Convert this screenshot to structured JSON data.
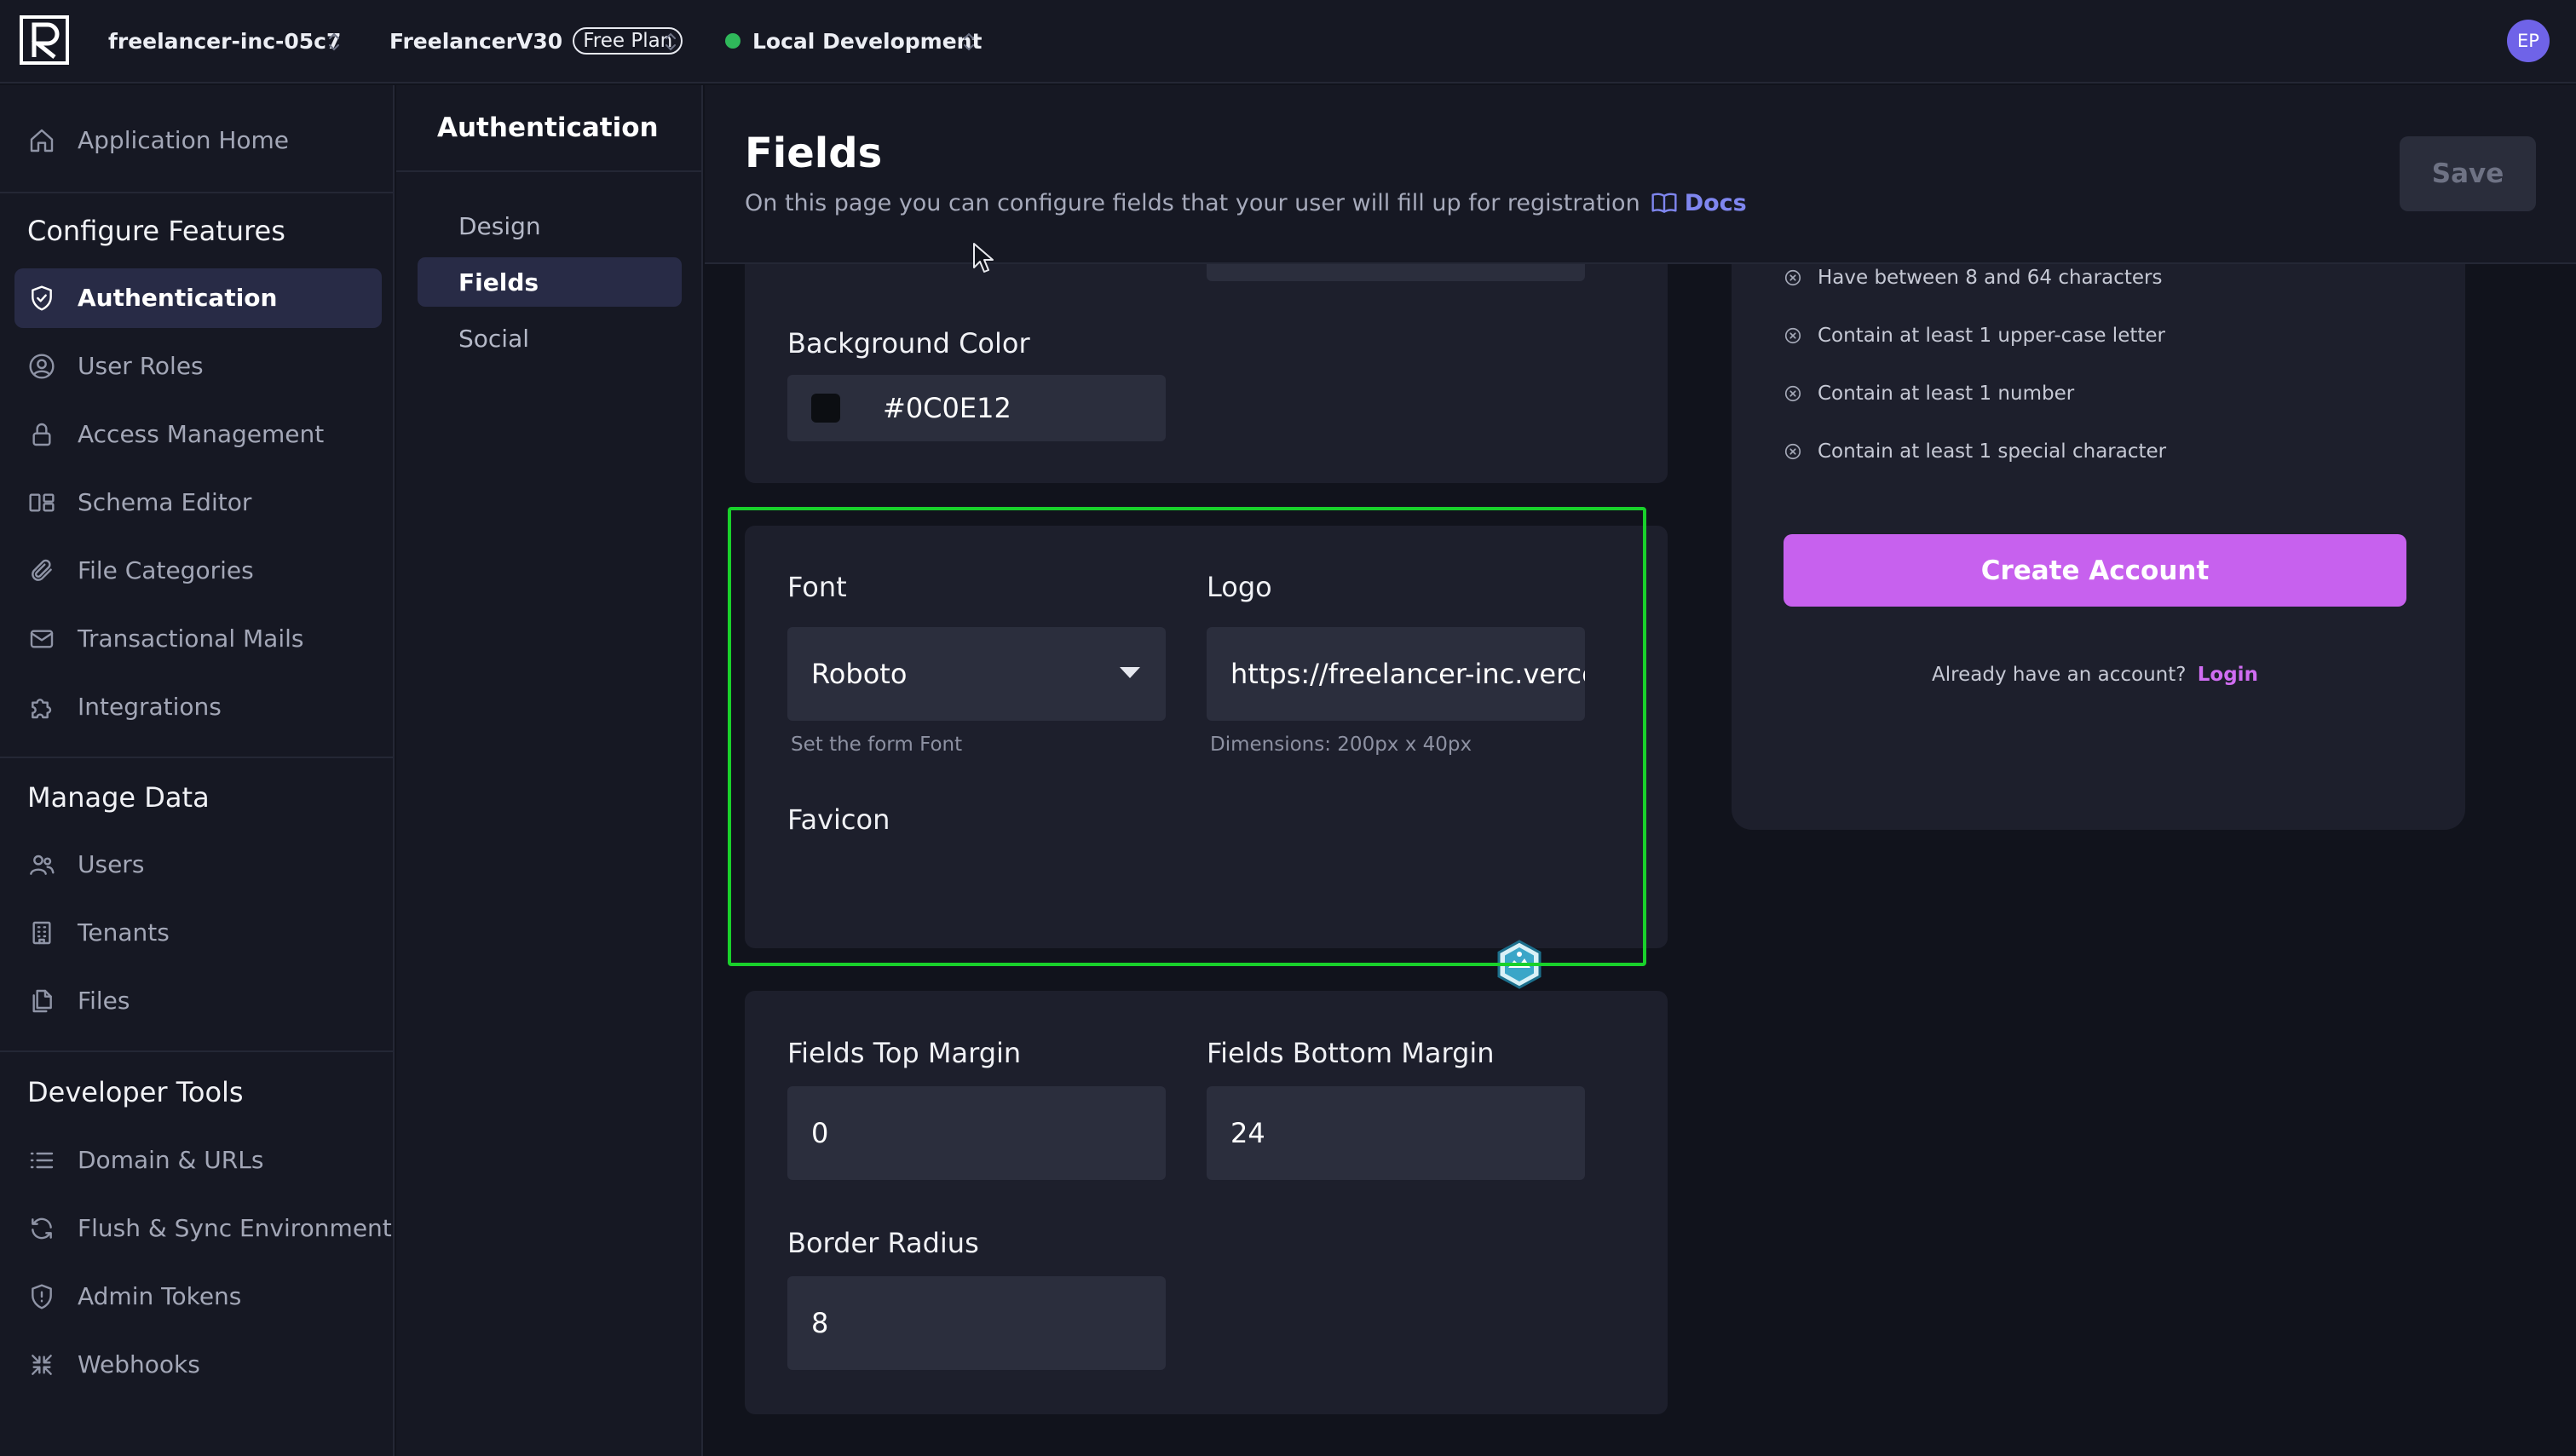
{
  "topbar": {
    "org": "freelancer-inc-05c7",
    "project": "FreelancerV30",
    "plan": "Free Plan",
    "environment": "Local Development",
    "avatar_initials": "EP"
  },
  "sidebar": {
    "home": "Application Home",
    "configure_title": "Configure Features",
    "configure_items": [
      {
        "label": "Authentication",
        "icon": "shield-check-icon",
        "active": true
      },
      {
        "label": "User Roles",
        "icon": "user-circle-icon"
      },
      {
        "label": "Access Management",
        "icon": "lock-icon"
      },
      {
        "label": "Schema Editor",
        "icon": "schema-icon"
      },
      {
        "label": "File Categories",
        "icon": "paperclip-icon"
      },
      {
        "label": "Transactional Mails",
        "icon": "mail-icon"
      },
      {
        "label": "Integrations",
        "icon": "puzzle-icon"
      }
    ],
    "manage_title": "Manage Data",
    "manage_items": [
      {
        "label": "Users",
        "icon": "users-icon"
      },
      {
        "label": "Tenants",
        "icon": "building-icon"
      },
      {
        "label": "Files",
        "icon": "files-icon"
      }
    ],
    "dev_title": "Developer Tools",
    "dev_items": [
      {
        "label": "Domain & URLs",
        "icon": "list-icon"
      },
      {
        "label": "Flush & Sync Environment",
        "icon": "refresh-icon"
      },
      {
        "label": "Admin Tokens",
        "icon": "shield-alert-icon"
      },
      {
        "label": "Webhooks",
        "icon": "webhook-icon"
      }
    ]
  },
  "subnav": {
    "title": "Authentication",
    "items": [
      {
        "label": "Design"
      },
      {
        "label": "Fields",
        "active": true
      },
      {
        "label": "Social"
      }
    ]
  },
  "header": {
    "title": "Fields",
    "description": "On this page you can configure fields that your user will fill up for registration",
    "docs_label": "Docs",
    "save_label": "Save"
  },
  "form": {
    "background_color_label": "Background Color",
    "background_color_value": "#0C0E12",
    "font_label": "Font",
    "font_value": "Roboto",
    "font_hint": "Set the form Font",
    "logo_label": "Logo",
    "logo_value": "https://freelancer-inc.verce",
    "logo_hint": "Dimensions: 200px x 40px",
    "favicon_label": "Favicon",
    "top_margin_label": "Fields Top Margin",
    "top_margin_value": "0",
    "bottom_margin_label": "Fields Bottom Margin",
    "bottom_margin_value": "24",
    "border_radius_label": "Border Radius",
    "border_radius_value": "8"
  },
  "preview": {
    "requirements": [
      "Have between 8 and 64 characters",
      "Contain at least 1 upper-case letter",
      "Contain at least 1 number",
      "Contain at least 1 special character"
    ],
    "create_button": "Create Account",
    "login_prompt": "Already have an account?",
    "login_link": "Login"
  },
  "colors": {
    "accent": "#C761EE",
    "active_nav": "#282B46",
    "highlight": "#19D12B",
    "env_status": "#2FB85A",
    "docs_link": "#7F86EF"
  }
}
